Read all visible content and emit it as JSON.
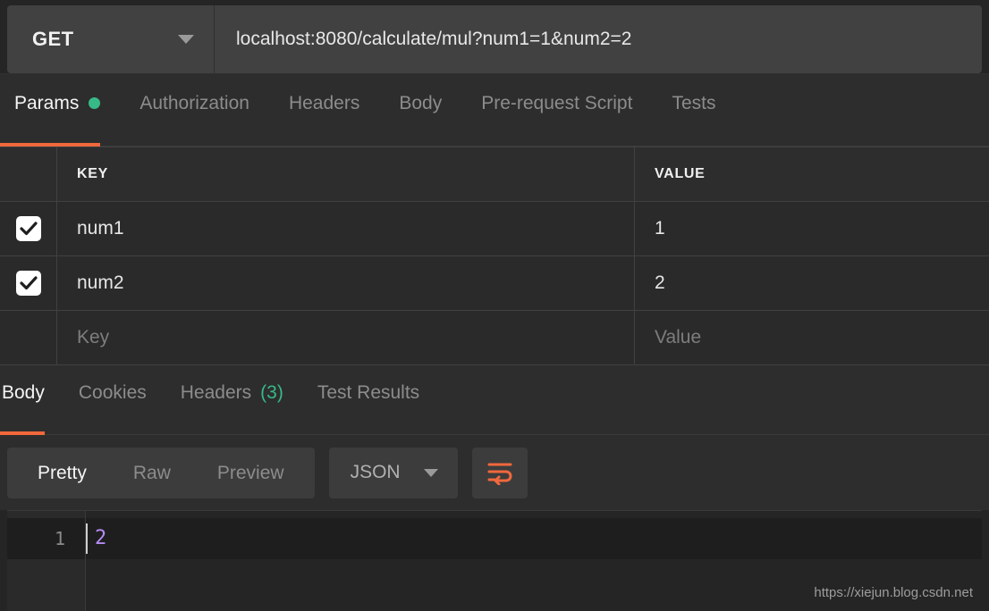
{
  "request": {
    "method": "GET",
    "method_caret_icon": "chevron-down-icon",
    "url": "localhost:8080/calculate/mul?num1=1&num2=2",
    "url_placeholder": "Enter request URL"
  },
  "request_tabs": [
    {
      "label": "Params",
      "active": true,
      "has_dot": true
    },
    {
      "label": "Authorization",
      "active": false,
      "has_dot": false
    },
    {
      "label": "Headers",
      "active": false,
      "has_dot": false
    },
    {
      "label": "Body",
      "active": false,
      "has_dot": false
    },
    {
      "label": "Pre-request Script",
      "active": false,
      "has_dot": false
    },
    {
      "label": "Tests",
      "active": false,
      "has_dot": false
    }
  ],
  "params_table": {
    "columns": {
      "key": "KEY",
      "value": "VALUE"
    },
    "rows": [
      {
        "checked": true,
        "key": "num1",
        "value": "1"
      },
      {
        "checked": true,
        "key": "num2",
        "value": "2"
      }
    ],
    "new_row": {
      "key_placeholder": "Key",
      "value_placeholder": "Value"
    }
  },
  "response_tabs": [
    {
      "label": "Body",
      "active": true,
      "count": ""
    },
    {
      "label": "Cookies",
      "active": false,
      "count": ""
    },
    {
      "label": "Headers",
      "active": false,
      "count": "(3)"
    },
    {
      "label": "Test Results",
      "active": false,
      "count": ""
    }
  ],
  "format_toolbar": {
    "view_modes": [
      {
        "label": "Pretty",
        "active": true
      },
      {
        "label": "Raw",
        "active": false
      },
      {
        "label": "Preview",
        "active": false
      }
    ],
    "language": "JSON",
    "language_caret_icon": "chevron-down-icon",
    "wrap_icon": "word-wrap-icon"
  },
  "response_body": {
    "line_numbers": [
      "1"
    ],
    "lines": [
      "2"
    ]
  },
  "watermark": "https://xiejun.blog.csdn.net",
  "colors": {
    "accent_orange": "#f1683c",
    "status_green": "#37b988",
    "value_purple": "#b48cf2",
    "bar_background": "#414141",
    "panel_background": "#2d2d2d",
    "page_background": "#252525"
  }
}
